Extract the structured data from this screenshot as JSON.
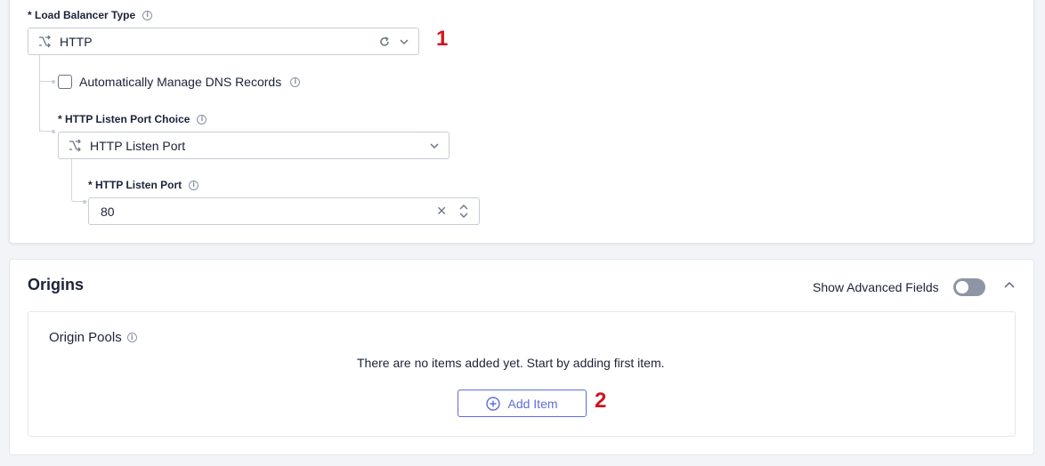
{
  "load_balancer": {
    "type_label": "* Load Balancer Type",
    "type_value": "HTTP",
    "dns_checkbox_label": "Automatically Manage DNS Records",
    "dns_checked": false,
    "port_choice_label": "* HTTP Listen Port Choice",
    "port_choice_value": "HTTP Listen Port",
    "port_label": "* HTTP Listen Port",
    "port_value": "80"
  },
  "origins": {
    "title": "Origins",
    "show_advanced_label": "Show Advanced Fields",
    "show_advanced_on": false,
    "pools_title": "Origin Pools",
    "empty_message": "There are no items added yet. Start by adding first item.",
    "add_button_label": "Add Item"
  },
  "annotations": {
    "badge1": "1",
    "badge2": "2"
  },
  "icons": {
    "info": "info-icon",
    "split": "split-arrow-icon",
    "chevron": "chevron-down-icon",
    "refresh": "refresh-icon",
    "clear": "clear-icon",
    "collapse": "chevron-up-icon",
    "plus": "plus-circle-icon"
  },
  "colors": {
    "accent": "#5f6cd6",
    "badge": "#d0141c",
    "toggle_off": "#8e95a4",
    "border": "#c7ccd6"
  }
}
